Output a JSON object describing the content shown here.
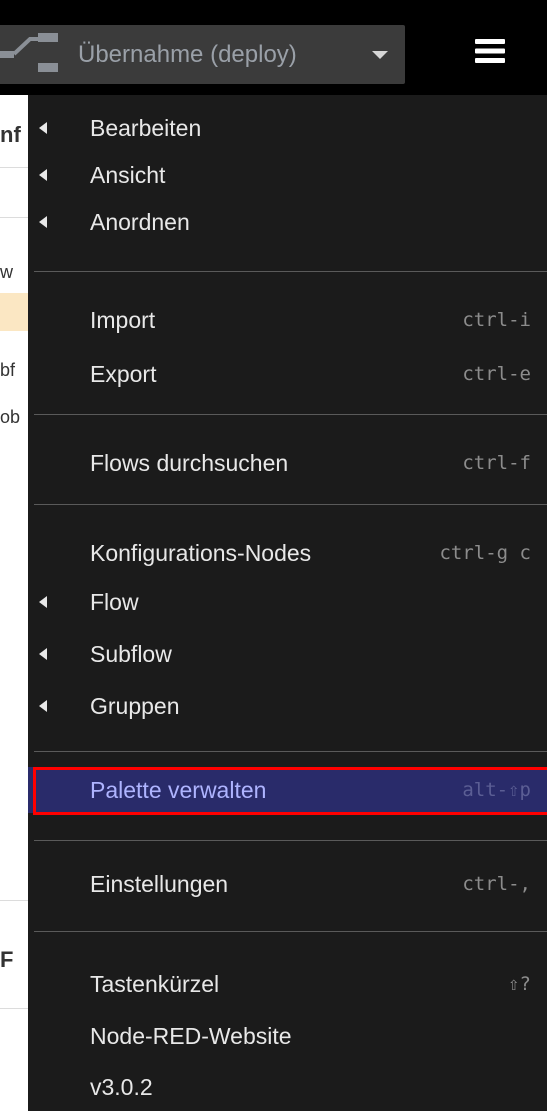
{
  "toolbar": {
    "deploy_label": "Übernahme (deploy)"
  },
  "background": {
    "fragments": [
      "nf",
      "w",
      "bf",
      "ob",
      "F"
    ]
  },
  "menu": {
    "edit": "Bearbeiten",
    "view": "Ansicht",
    "arrange": "Anordnen",
    "import": "Import",
    "import_shortcut": "ctrl-i",
    "export": "Export",
    "export_shortcut": "ctrl-e",
    "search": "Flows durchsuchen",
    "search_shortcut": "ctrl-f",
    "config_nodes": "Konfigurations-Nodes",
    "config_nodes_shortcut": "ctrl-g c",
    "flow": "Flow",
    "subflow": "Subflow",
    "groups": "Gruppen",
    "palette": "Palette verwalten",
    "palette_shortcut": "alt-⇧p",
    "settings": "Einstellungen",
    "settings_shortcut": "ctrl-,",
    "shortcuts": "Tastenkürzel",
    "shortcuts_shortcut": "⇧?",
    "website": "Node-RED-Website",
    "version": "v3.0.2"
  },
  "colors": {
    "menu_bg": "#1b1b1b",
    "active_bg": "#292b6a",
    "active_text": "#aeb4ff",
    "highlight_border": "#ff0000"
  },
  "icons": {
    "deploy": "deploy-icon",
    "caret": "caret-down-icon",
    "menu": "hamburger-menu-icon",
    "submenu": "caret-left-icon"
  }
}
